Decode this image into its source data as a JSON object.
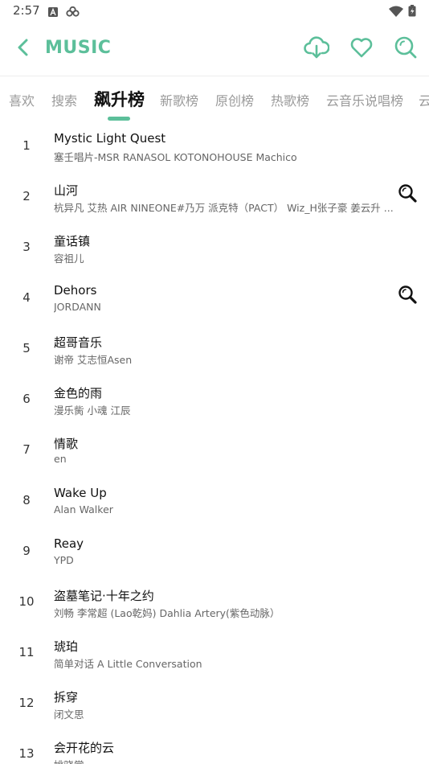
{
  "status_bar": {
    "time": "2:57"
  },
  "app_bar": {
    "title": "MUSIC"
  },
  "tabs": [
    {
      "label": "喜欢",
      "active": false
    },
    {
      "label": "搜索",
      "active": false
    },
    {
      "label": "飙升榜",
      "active": true
    },
    {
      "label": "新歌榜",
      "active": false
    },
    {
      "label": "原创榜",
      "active": false
    },
    {
      "label": "热歌榜",
      "active": false
    },
    {
      "label": "云音乐说唱榜",
      "active": false
    },
    {
      "label": "云",
      "active": false
    }
  ],
  "songs": [
    {
      "rank": "1",
      "title": "Mystic Light Quest",
      "artist": "塞壬唱片-MSR RANASOL KOTONOHOUSE Machico",
      "has_search": false
    },
    {
      "rank": "2",
      "title": "山河",
      "artist": " 杭异凡 艾热 AIR NINEONE#乃万 派克特（PACT） Wiz_H张子豪 姜云升 ...",
      "has_search": true
    },
    {
      "rank": "3",
      "title": "童话镇",
      "artist": "容祖儿",
      "has_search": false
    },
    {
      "rank": "4",
      "title": "Dehors",
      "artist": "JORDANN",
      "has_search": true
    },
    {
      "rank": "5",
      "title": "超哥音乐",
      "artist": "谢帝 艾志恒Asen",
      "has_search": false
    },
    {
      "rank": "6",
      "title": "金色的雨",
      "artist": "漫乐胔 小魂 江辰",
      "has_search": false
    },
    {
      "rank": "7",
      "title": "情歌",
      "artist": "en",
      "has_search": false
    },
    {
      "rank": "8",
      "title": "Wake Up",
      "artist": "Alan Walker",
      "has_search": false
    },
    {
      "rank": "9",
      "title": "Reay",
      "artist": "YPD",
      "has_search": false
    },
    {
      "rank": "10",
      "title": "盗墓笔记·十年之约",
      "artist": "刘畅 李常超 (Lao乾妈) Dahlia Artery(紫色动脉）",
      "has_search": false
    },
    {
      "rank": "11",
      "title": "琥珀",
      "artist": "简单对话 A Little Conversation",
      "has_search": false
    },
    {
      "rank": "12",
      "title": "拆穿",
      "artist": "闭文思",
      "has_search": false
    },
    {
      "rank": "13",
      "title": "会开花的云",
      "artist": "姚晓棠",
      "has_search": false
    }
  ],
  "colors": {
    "accent": "#5cbf9a",
    "text_primary": "#111111",
    "text_secondary": "#666666",
    "tab_inactive": "#9a9a9a"
  },
  "icons": [
    "back-arrow-icon",
    "cloud-download-icon",
    "heart-icon",
    "search-icon"
  ]
}
